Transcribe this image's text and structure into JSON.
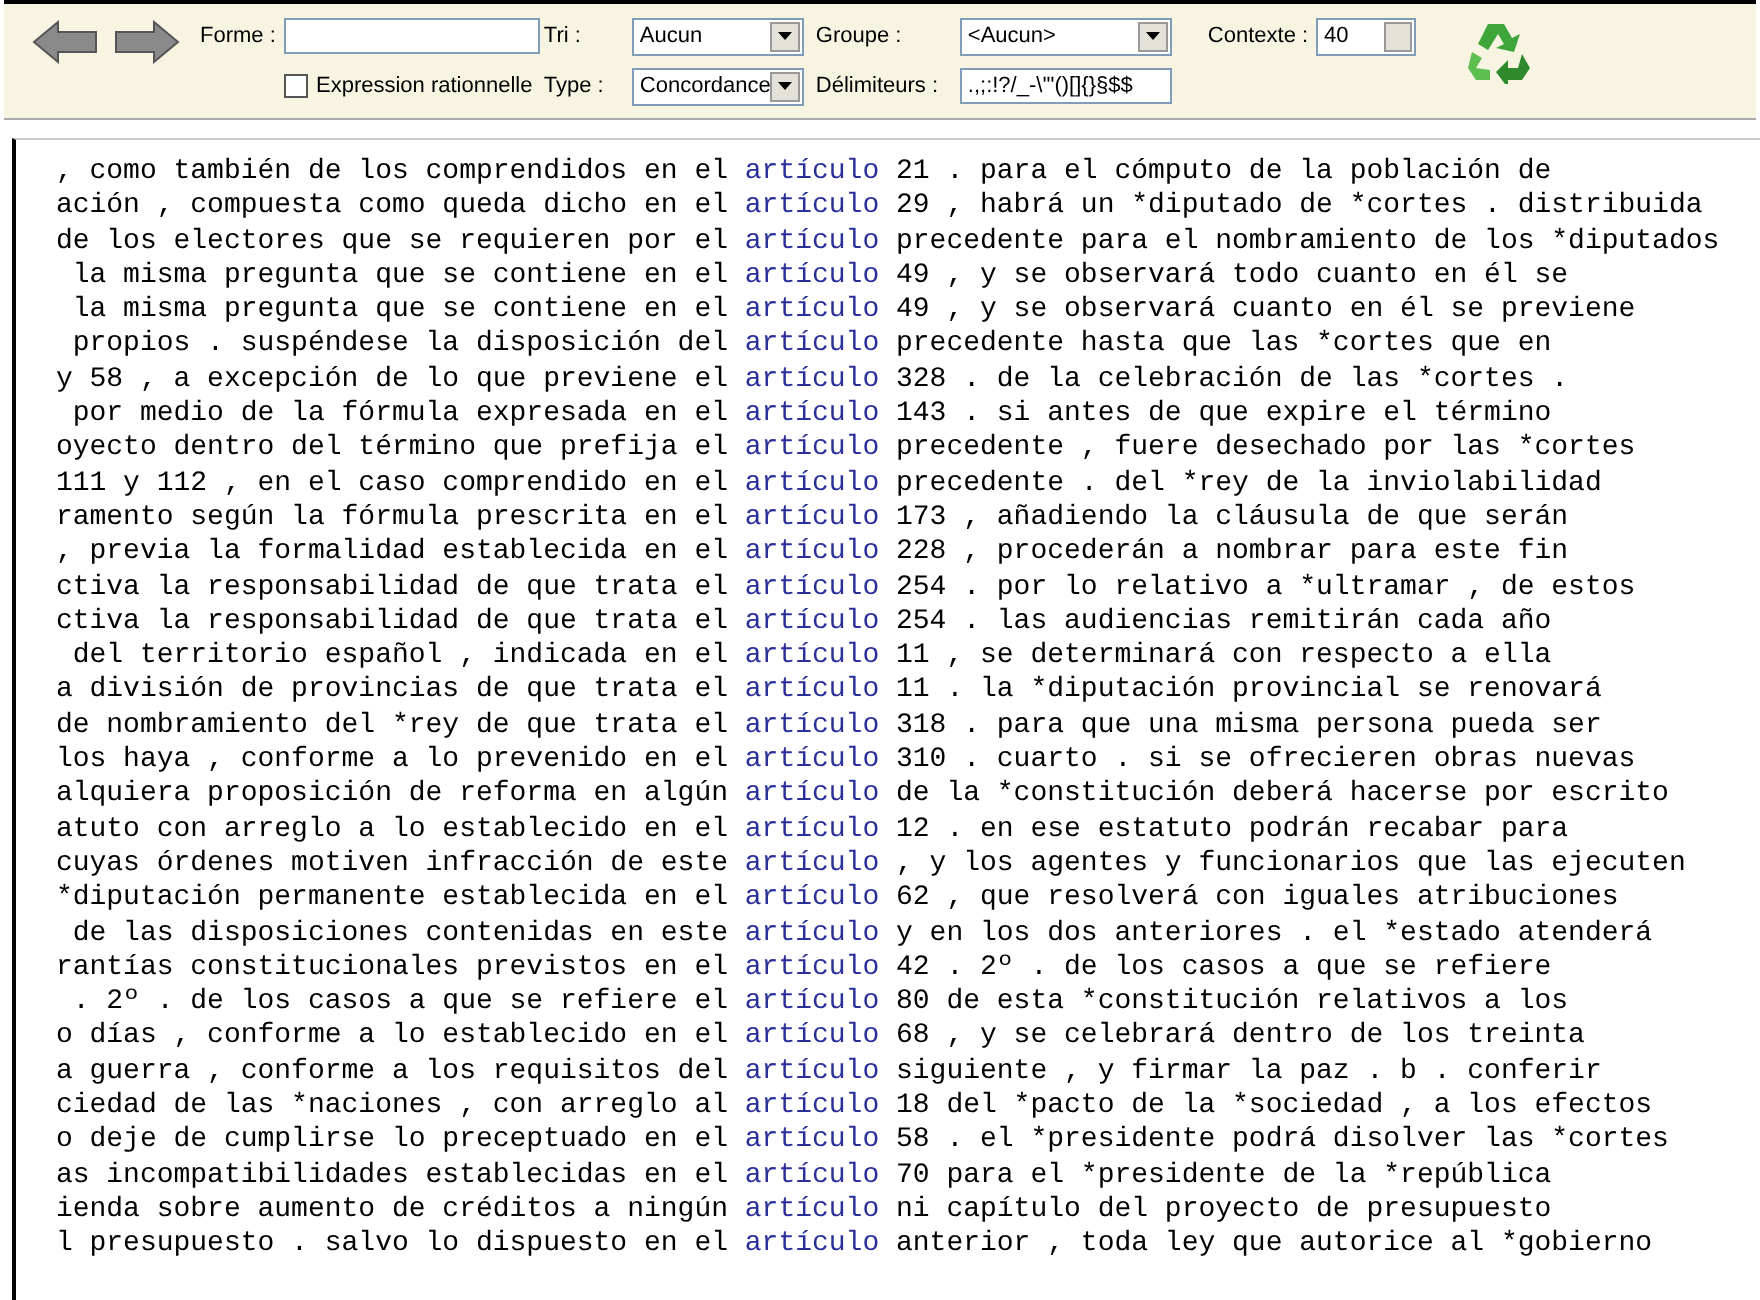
{
  "toolbar": {
    "forme": {
      "label": "Forme :"
    },
    "regex": {
      "label": "Expression rationnelle",
      "checked": false
    },
    "tri": {
      "label": "Tri :",
      "value": "Aucun"
    },
    "type": {
      "label": "Type :",
      "value": "Concordance"
    },
    "groupe": {
      "label": "Groupe :",
      "value": "<Aucun>"
    },
    "delimiteurs": {
      "label": "Délimiteurs :",
      "value": ".,;:!?/_-\\'\"()[]{}§$$"
    },
    "contexte": {
      "label": "Contexte :",
      "value": "40"
    }
  },
  "concordance": [
    {
      "left": ", como también de los comprendidos en el",
      "keyword": "artículo",
      "right": "21 . para el cómputo de la población de"
    },
    {
      "left": "ación , compuesta como queda dicho en el",
      "keyword": "artículo",
      "right": "29 , habrá un *diputado de *cortes . distribuida"
    },
    {
      "left": "de los electores que se requieren por el",
      "keyword": "artículo",
      "right": "precedente para el nombramiento de los *diputados"
    },
    {
      "left": " la misma pregunta que se contiene en el",
      "keyword": "artículo",
      "right": "49 , y se observará todo cuanto en él se"
    },
    {
      "left": " la misma pregunta que se contiene en el",
      "keyword": "artículo",
      "right": "49 , y se observará cuanto en él se previene"
    },
    {
      "left": " propios . suspéndese la disposición del",
      "keyword": "artículo",
      "right": "precedente hasta que las *cortes que en"
    },
    {
      "left": "y 58 , a excepción de lo que previene el",
      "keyword": "artículo",
      "right": "328 . de la celebración de las *cortes ."
    },
    {
      "left": " por medio de la fórmula expresada en el",
      "keyword": "artículo",
      "right": "143 . si antes de que expire el término"
    },
    {
      "left": "oyecto dentro del término que prefija el",
      "keyword": "artículo",
      "right": "precedente , fuere desechado por las *cortes"
    },
    {
      "left": "111 y 112 , en el caso comprendido en el",
      "keyword": "artículo",
      "right": "precedente . del *rey de la inviolabilidad"
    },
    {
      "left": "ramento según la fórmula prescrita en el",
      "keyword": "artículo",
      "right": "173 , añadiendo la cláusula de que serán"
    },
    {
      "left": ", previa la formalidad establecida en el",
      "keyword": "artículo",
      "right": "228 , procederán a nombrar para este fin"
    },
    {
      "left": "ctiva la responsabilidad de que trata el",
      "keyword": "artículo",
      "right": "254 . por lo relativo a *ultramar , de estos"
    },
    {
      "left": "ctiva la responsabilidad de que trata el",
      "keyword": "artículo",
      "right": "254 . las audiencias remitirán cada año"
    },
    {
      "left": " del territorio español , indicada en el",
      "keyword": "artículo",
      "right": "11 , se determinará con respecto a ella"
    },
    {
      "left": "a división de provincias de que trata el",
      "keyword": "artículo",
      "right": "11 . la *diputación provincial se renovará"
    },
    {
      "left": "de nombramiento del *rey de que trata el",
      "keyword": "artículo",
      "right": "318 . para que una misma persona pueda ser"
    },
    {
      "left": "los haya , conforme a lo prevenido en el",
      "keyword": "artículo",
      "right": "310 . cuarto . si se ofrecieren obras nuevas"
    },
    {
      "left": "alquiera proposición de reforma en algún",
      "keyword": "artículo",
      "right": "de la *constitución deberá hacerse por escrito"
    },
    {
      "left": "atuto con arreglo a lo establecido en el",
      "keyword": "artículo",
      "right": "12 . en ese estatuto podrán recabar para"
    },
    {
      "left": "cuyas órdenes motiven infracción de este",
      "keyword": "artículo",
      "right": ", y los agentes y funcionarios que las ejecuten"
    },
    {
      "left": "*diputación permanente establecida en el",
      "keyword": "artículo",
      "right": "62 , que resolverá con iguales atribuciones"
    },
    {
      "left": " de las disposiciones contenidas en este",
      "keyword": "artículo",
      "right": "y en los dos anteriores . el *estado atenderá"
    },
    {
      "left": "rantías constitucionales previstos en el",
      "keyword": "artículo",
      "right": "42 . 2º . de los casos a que se refiere"
    },
    {
      "left": " . 2º . de los casos a que se refiere el",
      "keyword": "artículo",
      "right": "80 de esta *constitución relativos a los"
    },
    {
      "left": "o días , conforme a lo establecido en el",
      "keyword": "artículo",
      "right": "68 , y se celebrará dentro de los treinta"
    },
    {
      "left": "a guerra , conforme a los requisitos del",
      "keyword": "artículo",
      "right": "siguiente , y firmar la paz . b . conferir"
    },
    {
      "left": "ciedad de las *naciones , con arreglo al",
      "keyword": "artículo",
      "right": "18 del *pacto de la *sociedad , a los efectos"
    },
    {
      "left": "o deje de cumplirse lo preceptuado en el",
      "keyword": "artículo",
      "right": "58 . el *presidente podrá disolver las *cortes"
    },
    {
      "left": "as incompatibilidades establecidas en el",
      "keyword": "artículo",
      "right": "70 para el *presidente de la *república"
    },
    {
      "left": "ienda sobre aumento de créditos a ningún",
      "keyword": "artículo",
      "right": "ni capítulo del proyecto de presupuesto"
    },
    {
      "left": "l presupuesto . salvo lo dispuesto en el",
      "keyword": "artículo",
      "right": "anterior , toda ley que autorice al *gobierno"
    }
  ]
}
